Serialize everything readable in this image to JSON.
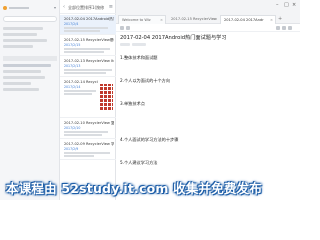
{
  "note_list": {
    "header_title": "全部位置排序1(按修",
    "items": [
      {
        "title": "2017-02-04 2017Android热门面试与学习",
        "date": "2017/2/4",
        "has_thumb": false
      },
      {
        "title": "2017-02-15 RecyclerView基础优化",
        "date": "2017/2/15",
        "has_thumb": false
      },
      {
        "title": "2017-02-13 RecyclerView ItemDecoration",
        "date": "2017/2/13",
        "has_thumb": false
      },
      {
        "title": "2017-02-14 RecyclerView 基础使用",
        "date": "2017/2/14",
        "has_thumb": true
      },
      {
        "title": "2017-02-10 RecyclerView 复杂布局",
        "date": "2017/2/10",
        "has_thumb": false
      },
      {
        "title": "2017-02-09 RecyclerView 学习",
        "date": "2017/2/9",
        "has_thumb": false
      }
    ]
  },
  "tabs": [
    {
      "label": "Welcome to Wiz"
    },
    {
      "label": "2017-02-15 RecyclerView"
    },
    {
      "label": "2017-02-04 2017Andr"
    }
  ],
  "editor": {
    "title": "2017-02-04 2017Android热门面试题与学习",
    "paragraphs": [
      "1.整体技术和面试题",
      "2.个人以为面试的十个方向",
      "3.单独技术点",
      "4.个人面试的学习方法的十步骤",
      "5.个人建议学习方法"
    ]
  },
  "watermark": {
    "text": "本课程由 52study.it.com 收集并免费发布"
  },
  "colors": {
    "accent": "#3a7bd5",
    "selected_bg": "#eaf1fb",
    "thumb_red": "#c0392b",
    "watermark_outline": "#1f5fa8"
  }
}
